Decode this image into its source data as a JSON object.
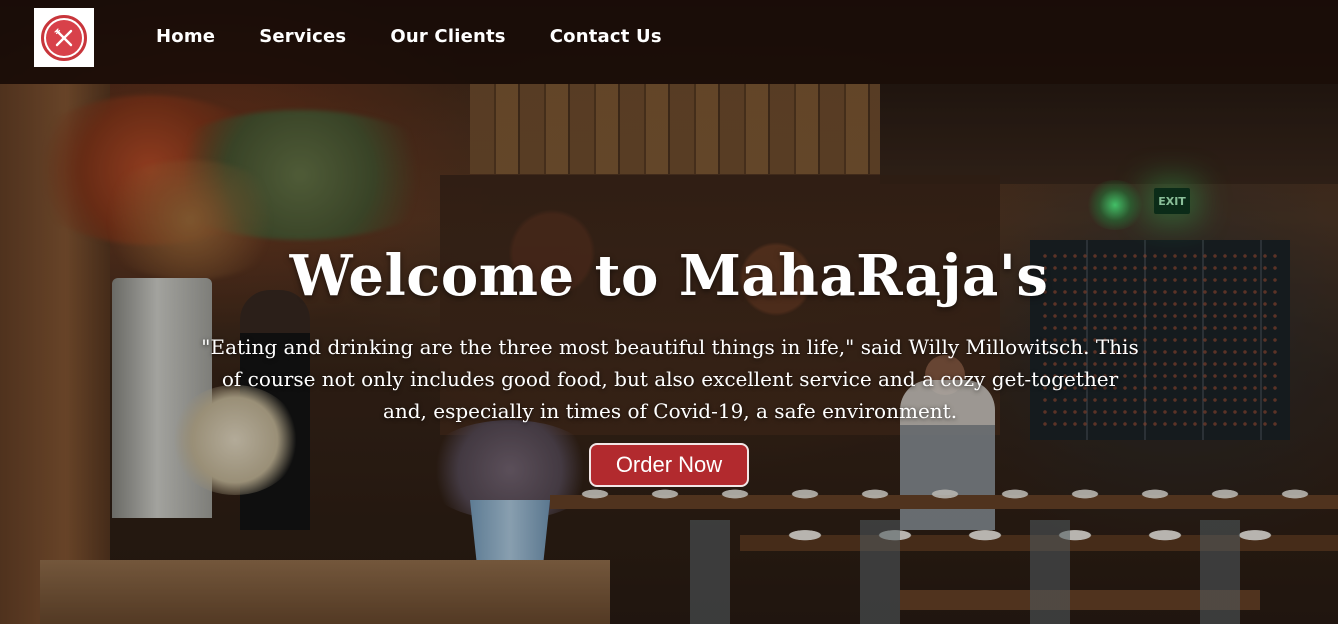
{
  "brand": {
    "logo_icon": "fork-and-knife-icon",
    "logo_color": "#c8353b"
  },
  "nav": {
    "items": [
      {
        "label": "Home"
      },
      {
        "label": "Services"
      },
      {
        "label": "Our Clients"
      },
      {
        "label": "Contact Us"
      }
    ]
  },
  "hero": {
    "title": "Welcome to MahaRaja's",
    "quote": "\"Eating and drinking are the three most beautiful things in life,\" said Willy Millowitsch. This of course not only includes good food, but also excellent service and a cozy get-together and, especially in times of Covid-19, a safe environment.",
    "button_label": "Order Now",
    "button_color": "#b22a2e",
    "exit_sign": "EXIT"
  }
}
